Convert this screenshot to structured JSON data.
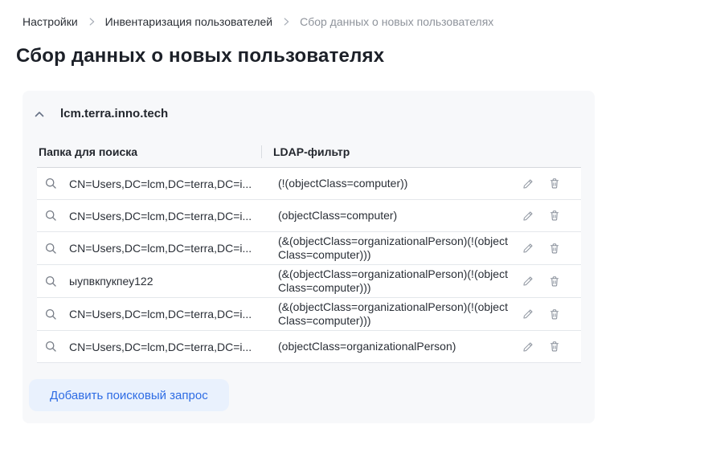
{
  "breadcrumb": {
    "items": [
      {
        "label": "Настройки"
      },
      {
        "label": "Инвентаризация пользователей"
      },
      {
        "label": "Сбор данных о новых пользователях"
      }
    ]
  },
  "page_title": "Сбор данных о новых пользователях",
  "section": {
    "title": "lcm.terra.inno.tech",
    "table": {
      "columns": [
        "Папка для поиска",
        "LDAP-фильтр"
      ],
      "rows": [
        {
          "folder": "CN=Users,DC=lcm,DC=terra,DC=i...",
          "filter": "(!(objectClass=computer))"
        },
        {
          "folder": "CN=Users,DC=lcm,DC=terra,DC=i...",
          "filter": "(objectClass=computer)"
        },
        {
          "folder": "CN=Users,DC=lcm,DC=terra,DC=i...",
          "filter": "(&(objectClass=organizationalPerson)(!(objectClass=computer)))"
        },
        {
          "folder": "ыупвкпукпеу122",
          "filter": "(&(objectClass=organizationalPerson)(!(objectClass=computer)))"
        },
        {
          "folder": "CN=Users,DC=lcm,DC=terra,DC=i...",
          "filter": "(&(objectClass=organizationalPerson)(!(objectClass=computer)))"
        },
        {
          "folder": "CN=Users,DC=lcm,DC=terra,DC=i...",
          "filter": "(objectClass=organizationalPerson)"
        }
      ]
    },
    "add_button_label": "Добавить поисковый запрос"
  },
  "icons": {
    "collapse": "chevron-up-icon",
    "breadcrumb_separator": "chevron-right-icon",
    "row_lookup": "search-icon",
    "edit": "pencil-icon",
    "delete": "trash-icon"
  },
  "colors": {
    "panel_bg": "#f7f8fa",
    "accent_blue": "#2e6ce4",
    "button_bg": "#e9f1fd",
    "muted_text": "#8e939b",
    "icon_gray": "#8a919c"
  }
}
